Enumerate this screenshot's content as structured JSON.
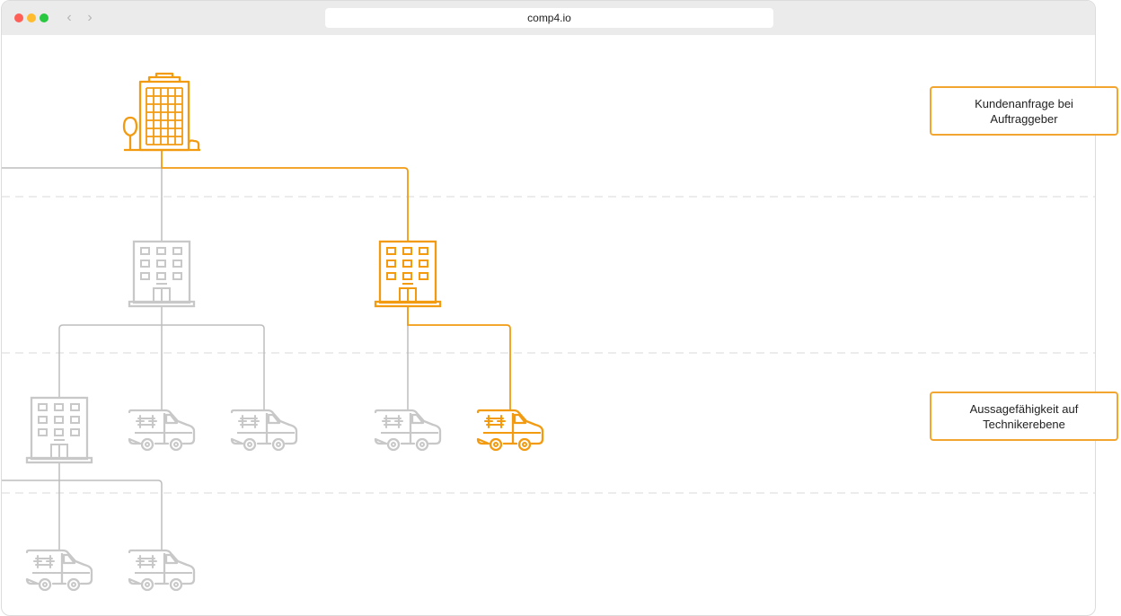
{
  "browser": {
    "url": "comp4.io",
    "back_icon": "chevron-left-icon",
    "forward_icon": "chevron-right-icon"
  },
  "colors": {
    "highlight": "#f29b11",
    "inactive": "#c8c8c8",
    "connector_inactive": "#bdbdbd",
    "callout_border": "#f2a630",
    "level_divider": "#e6e6e6"
  },
  "diagram": {
    "root_icon": "office-tower-icon",
    "branch_icon": "office-building-icon",
    "technician_icon": "service-van-icon",
    "highlighted_path": [
      "root",
      "branch-2",
      "van-4"
    ]
  },
  "callouts": {
    "request": "Kundenanfrage bei Auftraggeber",
    "technician_level": "Aussagefähigkeit auf Technikerebene"
  }
}
